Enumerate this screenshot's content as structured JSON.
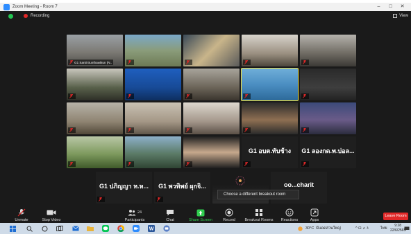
{
  "window": {
    "title": "Zoom Meeting - Room 7",
    "controls": [
      "–",
      "□",
      "✕"
    ]
  },
  "status": {
    "recording_label": "Recording",
    "view_label": "View"
  },
  "colors": {
    "accent": "#2d8cff",
    "record": "#e02828",
    "share_green": "#2fce4e",
    "speaker_outline": "#f0e040",
    "leave": "#e02828"
  },
  "tiles": [
    {
      "name": "G1 Santi Bunthawikun (N..",
      "big": ""
    },
    {
      "name": "",
      "big": ""
    },
    {
      "name": "",
      "big": ""
    },
    {
      "name": "",
      "big": ""
    },
    {
      "name": "",
      "big": ""
    },
    {
      "name": "",
      "big": ""
    },
    {
      "name": "",
      "big": ""
    },
    {
      "name": "",
      "big": ""
    },
    {
      "name": "",
      "big": ""
    },
    {
      "name": "",
      "big": ""
    },
    {
      "name": "",
      "big": ""
    },
    {
      "name": "",
      "big": ""
    },
    {
      "name": "",
      "big": ""
    },
    {
      "name": "",
      "big": ""
    },
    {
      "name": "",
      "big": ""
    },
    {
      "name": "",
      "big": ""
    },
    {
      "name": "",
      "big": ""
    },
    {
      "name": "",
      "big": ""
    },
    {
      "name": "",
      "big": ""
    },
    {
      "name": "",
      "big": ""
    },
    {
      "name": "",
      "big": "G1 อบต.ทับช้าง"
    },
    {
      "name": "",
      "big": "G1 ลองกด.พ.บ่อล..."
    },
    {
      "name": "",
      "big": "G1 ปภิญญา ห.ห..."
    },
    {
      "name": "",
      "big": "G1 พวทิพย์ ผุกจิ..."
    },
    {
      "name": "",
      "big": ""
    },
    {
      "name": "",
      "big": "oo...charit"
    }
  ],
  "tooltip": "Choose a different breakout room",
  "toolbar": {
    "unmute": "Unmute",
    "stop_video": "Stop Video",
    "participants": "Participants",
    "participants_count": "24",
    "chat": "Chat",
    "share_screen": "Share Screen",
    "record": "Record",
    "breakout_rooms": "Breakout Rooms",
    "reactions": "Reactions",
    "apps": "Apps",
    "leave_room": "Leave Room"
  },
  "taskbar": {
    "weather": "30°C",
    "weather_text": "มีแดดส่วนใหญ่",
    "tray_symbols": "^ ⊡ ♫ ʖ",
    "lang": "ไทย",
    "time": "9:28",
    "date": "22/6/2565"
  }
}
